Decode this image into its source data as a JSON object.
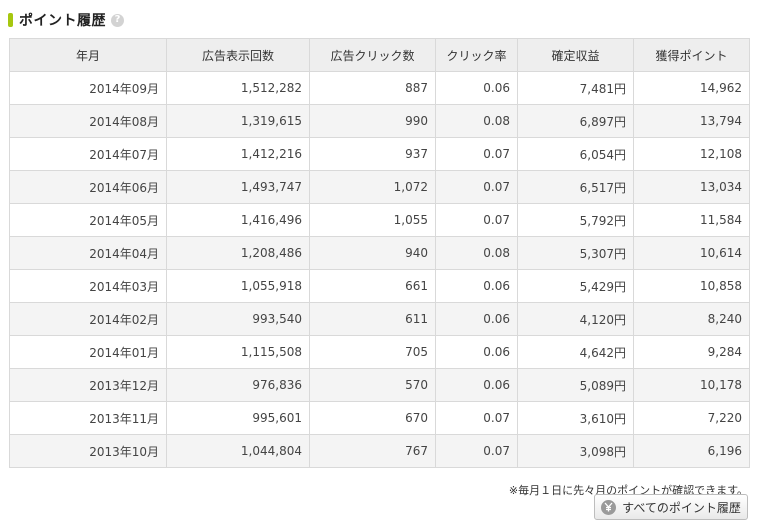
{
  "section": {
    "title": "ポイント履歴",
    "help_icon": "help-icon",
    "help_glyph": "?"
  },
  "table": {
    "headers": [
      "年月",
      "広告表示回数",
      "広告クリック数",
      "クリック率",
      "確定収益",
      "獲得ポイント"
    ],
    "rows": [
      [
        "2014年09月",
        "1,512,282",
        "887",
        "0.06",
        "7,481円",
        "14,962"
      ],
      [
        "2014年08月",
        "1,319,615",
        "990",
        "0.08",
        "6,897円",
        "13,794"
      ],
      [
        "2014年07月",
        "1,412,216",
        "937",
        "0.07",
        "6,054円",
        "12,108"
      ],
      [
        "2014年06月",
        "1,493,747",
        "1,072",
        "0.07",
        "6,517円",
        "13,034"
      ],
      [
        "2014年05月",
        "1,416,496",
        "1,055",
        "0.07",
        "5,792円",
        "11,584"
      ],
      [
        "2014年04月",
        "1,208,486",
        "940",
        "0.08",
        "5,307円",
        "10,614"
      ],
      [
        "2014年03月",
        "1,055,918",
        "661",
        "0.06",
        "5,429円",
        "10,858"
      ],
      [
        "2014年02月",
        "993,540",
        "611",
        "0.06",
        "4,120円",
        "8,240"
      ],
      [
        "2014年01月",
        "1,115,508",
        "705",
        "0.06",
        "4,642円",
        "9,284"
      ],
      [
        "2013年12月",
        "976,836",
        "570",
        "0.06",
        "5,089円",
        "10,178"
      ],
      [
        "2013年11月",
        "995,601",
        "670",
        "0.07",
        "3,610円",
        "7,220"
      ],
      [
        "2013年10月",
        "1,044,804",
        "767",
        "0.07",
        "3,098円",
        "6,196"
      ]
    ]
  },
  "footer": {
    "note": "※毎月１日に先々月のポイントが確認できます。",
    "all_history_button": "すべてのポイント履歴",
    "button_icon": "yen-coin-icon"
  },
  "colors": {
    "accent": "#a6c70f",
    "header_bg": "#eeeeee",
    "stripe_bg": "#f4f4f4",
    "border": "#d9d9d9"
  }
}
